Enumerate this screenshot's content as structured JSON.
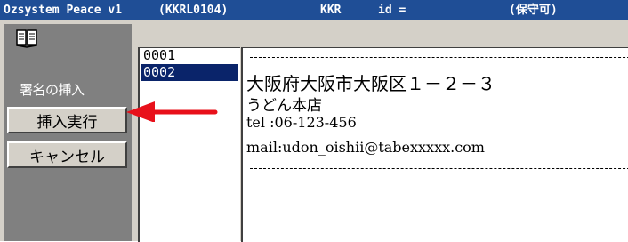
{
  "titlebar": {
    "app": "Ozsystem Peace v1",
    "code": "(KKRL0104)",
    "user": "KKR",
    "id_label": "id =",
    "status": "(保守可)"
  },
  "left_panel": {
    "icon": "book-icon",
    "section_label": "署名の挿入",
    "insert_button": "挿入実行",
    "cancel_button": "キャンセル"
  },
  "signature_list": {
    "items": [
      "0001",
      "0002"
    ],
    "selected_index": 1
  },
  "signature_detail": {
    "address": "大阪府大阪市大阪区１－２－３",
    "shop_name": "うどん本店",
    "tel": "tel :06-123-456",
    "mail": "mail:udon_oishii@tabexxxxx.com"
  },
  "annotation": {
    "arrow_color": "#e8101a",
    "points_to": "insert_button"
  },
  "colors": {
    "titlebar_bg": "#1f4e96",
    "panel_gray": "#808080",
    "selection": "#0a246a"
  }
}
